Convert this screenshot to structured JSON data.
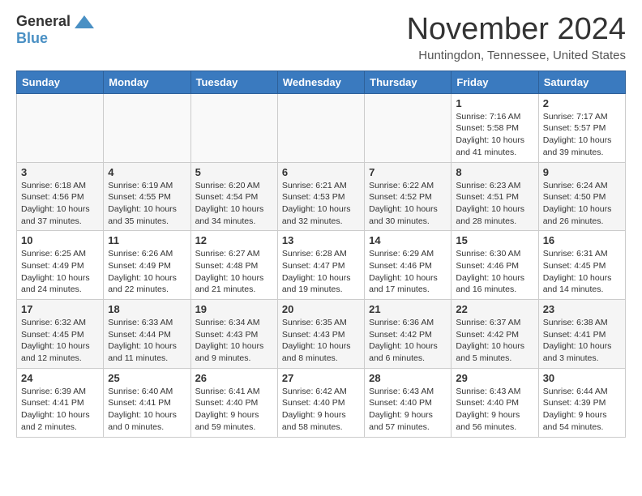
{
  "logo": {
    "general": "General",
    "blue": "Blue"
  },
  "title": "November 2024",
  "location": "Huntingdon, Tennessee, United States",
  "weekdays": [
    "Sunday",
    "Monday",
    "Tuesday",
    "Wednesday",
    "Thursday",
    "Friday",
    "Saturday"
  ],
  "weeks": [
    [
      {
        "day": "",
        "info": ""
      },
      {
        "day": "",
        "info": ""
      },
      {
        "day": "",
        "info": ""
      },
      {
        "day": "",
        "info": ""
      },
      {
        "day": "",
        "info": ""
      },
      {
        "day": "1",
        "info": "Sunrise: 7:16 AM\nSunset: 5:58 PM\nDaylight: 10 hours and 41 minutes."
      },
      {
        "day": "2",
        "info": "Sunrise: 7:17 AM\nSunset: 5:57 PM\nDaylight: 10 hours and 39 minutes."
      }
    ],
    [
      {
        "day": "3",
        "info": "Sunrise: 6:18 AM\nSunset: 4:56 PM\nDaylight: 10 hours and 37 minutes."
      },
      {
        "day": "4",
        "info": "Sunrise: 6:19 AM\nSunset: 4:55 PM\nDaylight: 10 hours and 35 minutes."
      },
      {
        "day": "5",
        "info": "Sunrise: 6:20 AM\nSunset: 4:54 PM\nDaylight: 10 hours and 34 minutes."
      },
      {
        "day": "6",
        "info": "Sunrise: 6:21 AM\nSunset: 4:53 PM\nDaylight: 10 hours and 32 minutes."
      },
      {
        "day": "7",
        "info": "Sunrise: 6:22 AM\nSunset: 4:52 PM\nDaylight: 10 hours and 30 minutes."
      },
      {
        "day": "8",
        "info": "Sunrise: 6:23 AM\nSunset: 4:51 PM\nDaylight: 10 hours and 28 minutes."
      },
      {
        "day": "9",
        "info": "Sunrise: 6:24 AM\nSunset: 4:50 PM\nDaylight: 10 hours and 26 minutes."
      }
    ],
    [
      {
        "day": "10",
        "info": "Sunrise: 6:25 AM\nSunset: 4:49 PM\nDaylight: 10 hours and 24 minutes."
      },
      {
        "day": "11",
        "info": "Sunrise: 6:26 AM\nSunset: 4:49 PM\nDaylight: 10 hours and 22 minutes."
      },
      {
        "day": "12",
        "info": "Sunrise: 6:27 AM\nSunset: 4:48 PM\nDaylight: 10 hours and 21 minutes."
      },
      {
        "day": "13",
        "info": "Sunrise: 6:28 AM\nSunset: 4:47 PM\nDaylight: 10 hours and 19 minutes."
      },
      {
        "day": "14",
        "info": "Sunrise: 6:29 AM\nSunset: 4:46 PM\nDaylight: 10 hours and 17 minutes."
      },
      {
        "day": "15",
        "info": "Sunrise: 6:30 AM\nSunset: 4:46 PM\nDaylight: 10 hours and 16 minutes."
      },
      {
        "day": "16",
        "info": "Sunrise: 6:31 AM\nSunset: 4:45 PM\nDaylight: 10 hours and 14 minutes."
      }
    ],
    [
      {
        "day": "17",
        "info": "Sunrise: 6:32 AM\nSunset: 4:45 PM\nDaylight: 10 hours and 12 minutes."
      },
      {
        "day": "18",
        "info": "Sunrise: 6:33 AM\nSunset: 4:44 PM\nDaylight: 10 hours and 11 minutes."
      },
      {
        "day": "19",
        "info": "Sunrise: 6:34 AM\nSunset: 4:43 PM\nDaylight: 10 hours and 9 minutes."
      },
      {
        "day": "20",
        "info": "Sunrise: 6:35 AM\nSunset: 4:43 PM\nDaylight: 10 hours and 8 minutes."
      },
      {
        "day": "21",
        "info": "Sunrise: 6:36 AM\nSunset: 4:42 PM\nDaylight: 10 hours and 6 minutes."
      },
      {
        "day": "22",
        "info": "Sunrise: 6:37 AM\nSunset: 4:42 PM\nDaylight: 10 hours and 5 minutes."
      },
      {
        "day": "23",
        "info": "Sunrise: 6:38 AM\nSunset: 4:41 PM\nDaylight: 10 hours and 3 minutes."
      }
    ],
    [
      {
        "day": "24",
        "info": "Sunrise: 6:39 AM\nSunset: 4:41 PM\nDaylight: 10 hours and 2 minutes."
      },
      {
        "day": "25",
        "info": "Sunrise: 6:40 AM\nSunset: 4:41 PM\nDaylight: 10 hours and 0 minutes."
      },
      {
        "day": "26",
        "info": "Sunrise: 6:41 AM\nSunset: 4:40 PM\nDaylight: 9 hours and 59 minutes."
      },
      {
        "day": "27",
        "info": "Sunrise: 6:42 AM\nSunset: 4:40 PM\nDaylight: 9 hours and 58 minutes."
      },
      {
        "day": "28",
        "info": "Sunrise: 6:43 AM\nSunset: 4:40 PM\nDaylight: 9 hours and 57 minutes."
      },
      {
        "day": "29",
        "info": "Sunrise: 6:43 AM\nSunset: 4:40 PM\nDaylight: 9 hours and 56 minutes."
      },
      {
        "day": "30",
        "info": "Sunrise: 6:44 AM\nSunset: 4:39 PM\nDaylight: 9 hours and 54 minutes."
      }
    ]
  ]
}
